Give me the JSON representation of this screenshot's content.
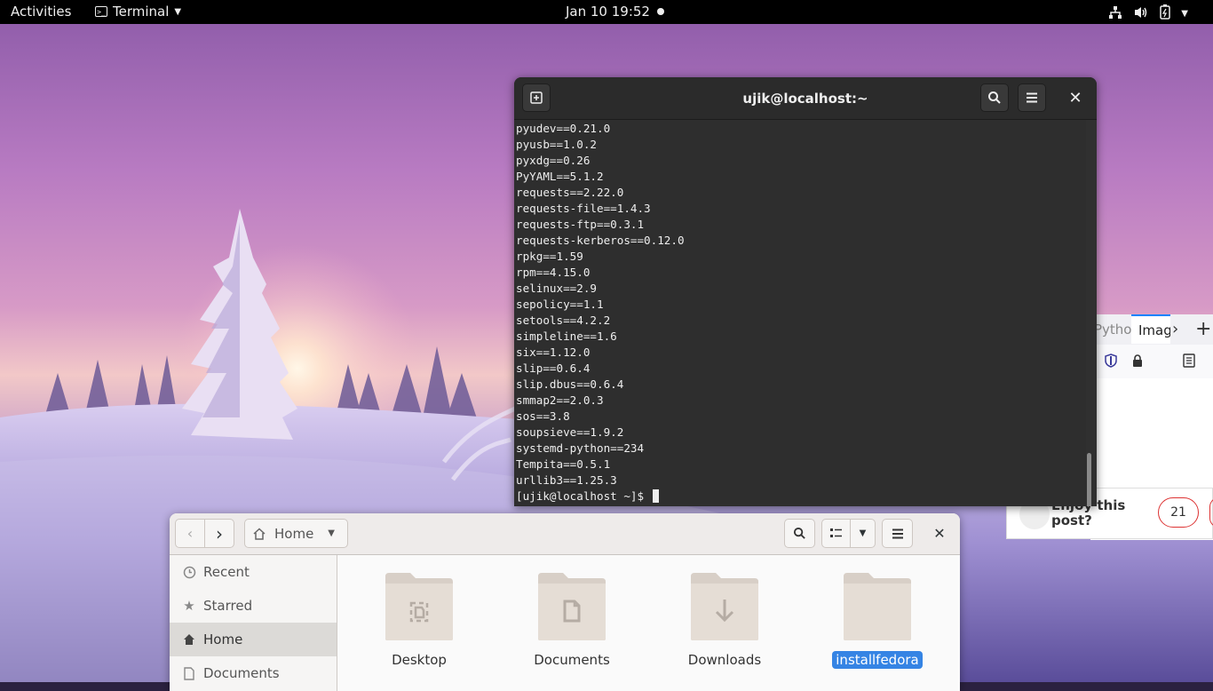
{
  "topbar": {
    "activities": "Activities",
    "app_name": "Terminal",
    "clock": "Jan 10  19:52"
  },
  "terminal": {
    "title": "ujik@localhost:~",
    "lines": [
      "pyudev==0.21.0",
      "pyusb==1.0.2",
      "pyxdg==0.26",
      "PyYAML==5.1.2",
      "requests==2.22.0",
      "requests-file==1.4.3",
      "requests-ftp==0.3.1",
      "requests-kerberos==0.12.0",
      "rpkg==1.59",
      "rpm==4.15.0",
      "selinux==2.9",
      "sepolicy==1.1",
      "setools==4.2.2",
      "simpleline==1.6",
      "six==1.12.0",
      "slip==0.6.4",
      "slip.dbus==0.6.4",
      "smmap2==2.0.3",
      "sos==3.8",
      "soupsieve==1.9.2",
      "systemd-python==234",
      "Tempita==0.5.1",
      "urllib3==1.25.3"
    ],
    "prompt": "[ujik@localhost ~]$ "
  },
  "browser": {
    "tab1": "Pytho",
    "tab2": "Imag",
    "enjoy": "Enjoy this post?",
    "count": "21"
  },
  "files": {
    "path_label": "Home",
    "sidebar": [
      {
        "label": "Recent",
        "icon": "clock-icon"
      },
      {
        "label": "Starred",
        "icon": "star-icon"
      },
      {
        "label": "Home",
        "icon": "home-icon"
      },
      {
        "label": "Documents",
        "icon": "document-icon"
      }
    ],
    "folders": [
      {
        "label": "Desktop",
        "emblem": "desktop"
      },
      {
        "label": "Documents",
        "emblem": "document"
      },
      {
        "label": "Downloads",
        "emblem": "download"
      },
      {
        "label": "installfedora",
        "emblem": "none",
        "selected": true
      }
    ]
  },
  "colors": {
    "accent": "#3584e4",
    "terminal_bg": "#2e2e2e",
    "topbar_bg": "#000000",
    "folder": "#d8cfc7"
  }
}
